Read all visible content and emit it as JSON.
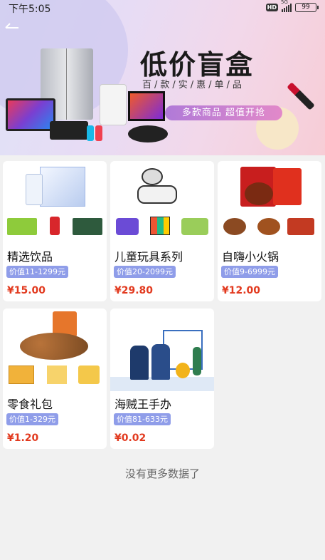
{
  "status_bar": {
    "time": "下午5:05",
    "hd": "HD",
    "network": "5G",
    "battery": "99"
  },
  "banner": {
    "back_icon": "back-arrow-icon",
    "title": "低价盲盒",
    "subtitle": "百/款/实/惠/单/品",
    "pill": "多款商品 超值开抢"
  },
  "products": [
    {
      "name": "精选饮品",
      "range": "价值11-1299元",
      "price": "¥15.00"
    },
    {
      "name": "儿童玩具系列",
      "range": "价值20-2099元",
      "price": "¥29.80"
    },
    {
      "name": "自嗨小火锅",
      "range": "价值9-6999元",
      "price": "¥12.00"
    },
    {
      "name": "零食礼包",
      "range": "价值1-329元",
      "price": "¥1.20"
    },
    {
      "name": "海贼王手办",
      "range": "价值81-633元",
      "price": "¥0.02"
    }
  ],
  "footer_text": "没有更多数据了",
  "colors": {
    "price": "#e23a1f",
    "range_badge": "#8f9de9",
    "page_bg": "#f1f1f1"
  }
}
